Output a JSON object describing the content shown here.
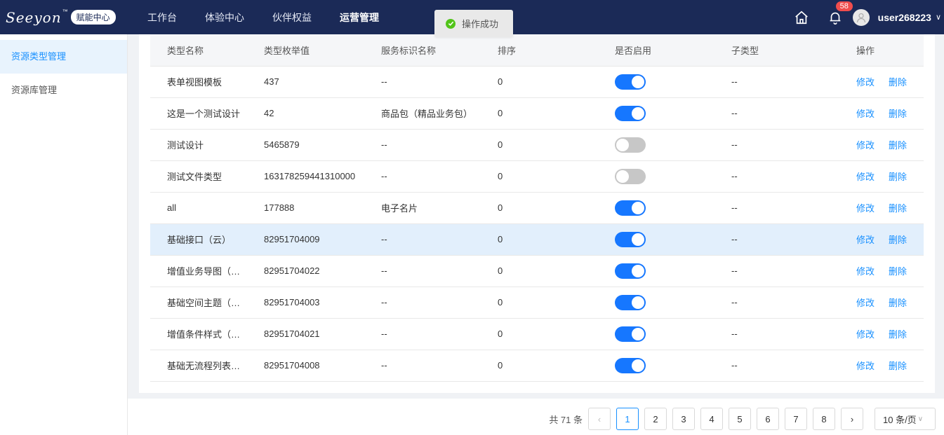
{
  "header": {
    "logo_text": "Seeyon",
    "logo_tm": "™",
    "logo_badge": "赋能中心",
    "nav": [
      "工作台",
      "体验中心",
      "伙伴权益",
      "运营管理"
    ],
    "active_nav_index": 3,
    "notification_count": "58",
    "username": "user268223",
    "user_chevron": "∨"
  },
  "toast": {
    "text": "操作成功",
    "icon": "check-circle-icon",
    "color": "#52c41a"
  },
  "sidebar": {
    "items": [
      {
        "label": "资源类型管理",
        "active": true
      },
      {
        "label": "资源库管理",
        "active": false
      }
    ]
  },
  "table": {
    "columns": [
      "类型名称",
      "类型枚举值",
      "服务标识名称",
      "排序",
      "是否启用",
      "子类型",
      "操作"
    ],
    "edit_label": "修改",
    "delete_label": "删除",
    "rows": [
      {
        "name": "表单视图模板",
        "enum": "437",
        "service": "--",
        "sort": "0",
        "enabled": true,
        "sub": "--"
      },
      {
        "name": "这是一个测试设计",
        "enum": "42",
        "service": "商品包（精品业务包）",
        "sort": "0",
        "enabled": true,
        "sub": "--"
      },
      {
        "name": "测试设计",
        "enum": "5465879",
        "service": "--",
        "sort": "0",
        "enabled": false,
        "sub": "--"
      },
      {
        "name": "测试文件类型",
        "enum": "163178259441310000",
        "service": "--",
        "sort": "0",
        "enabled": false,
        "sub": "--"
      },
      {
        "name": "all",
        "enum": "177888",
        "service": "电子名片",
        "sort": "0",
        "enabled": true,
        "sub": "--"
      },
      {
        "name": "基础接口（云）",
        "enum": "82951704009",
        "service": "--",
        "sort": "0",
        "enabled": true,
        "sub": "--",
        "highlight": true
      },
      {
        "name": "增值业务导图（云）",
        "enum": "82951704022",
        "service": "--",
        "sort": "0",
        "enabled": true,
        "sub": "--"
      },
      {
        "name": "基础空间主题（云）",
        "enum": "82951704003",
        "service": "--",
        "sort": "0",
        "enabled": true,
        "sub": "--"
      },
      {
        "name": "增值条件样式（云）",
        "enum": "82951704021",
        "service": "--",
        "sort": "0",
        "enabled": true,
        "sub": "--"
      },
      {
        "name": "基础无流程列表（云）",
        "enum": "82951704008",
        "service": "--",
        "sort": "0",
        "enabled": true,
        "sub": "--"
      }
    ]
  },
  "pagination": {
    "total_label": "共 71 条",
    "prev_icon": "‹",
    "next_icon": "›",
    "pages": [
      "1",
      "2",
      "3",
      "4",
      "5",
      "6",
      "7",
      "8"
    ],
    "current_page": "1",
    "page_size_label": "10 条/页",
    "page_size_chevron": "∨"
  },
  "colors": {
    "header_bg": "#1b2a57",
    "accent": "#1890ff",
    "toggle_on": "#1677ff",
    "toggle_off": "#c7c7c7",
    "badge": "#f04d4d"
  }
}
